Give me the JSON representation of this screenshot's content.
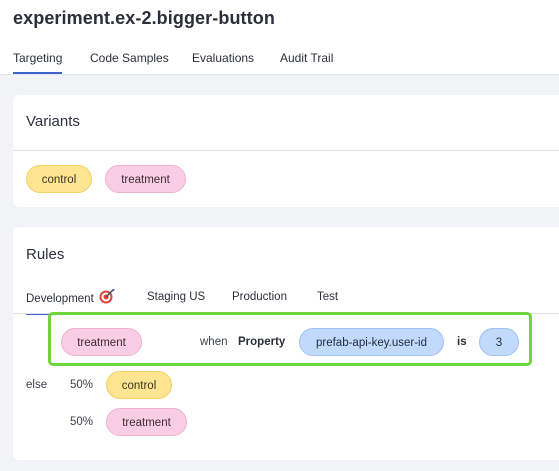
{
  "header": {
    "title": "experiment.ex-2.bigger-button",
    "tabs": [
      {
        "label": "Targeting",
        "active": true
      },
      {
        "label": "Code Samples",
        "active": false
      },
      {
        "label": "Evaluations",
        "active": false
      },
      {
        "label": "Audit Trail",
        "active": false
      }
    ]
  },
  "variants": {
    "title": "Variants",
    "items": [
      {
        "label": "control",
        "color": "#fde592"
      },
      {
        "label": "treatment",
        "color": "#f9cde4"
      }
    ]
  },
  "rules": {
    "title": "Rules",
    "env_tabs": [
      {
        "label": "Development",
        "active": true,
        "icon": "target-icon"
      },
      {
        "label": "Staging US",
        "active": false
      },
      {
        "label": "Production",
        "active": false
      },
      {
        "label": "Test",
        "active": false
      }
    ],
    "rule": {
      "variant": "treatment",
      "when": "when",
      "property_label": "Property",
      "property": "prefab-api-key.user-id",
      "operator": "is",
      "value": "3"
    },
    "else": {
      "label": "else",
      "splits": [
        {
          "percent": "50%",
          "variant": "control"
        },
        {
          "percent": "50%",
          "variant": "treatment"
        }
      ]
    }
  },
  "colors": {
    "highlight": "#6fd53c",
    "tab_underline": "#3e63c9",
    "yellow_pill": "#fde592",
    "pink_pill": "#f9cde4",
    "blue_pill": "#c1d9fb"
  }
}
